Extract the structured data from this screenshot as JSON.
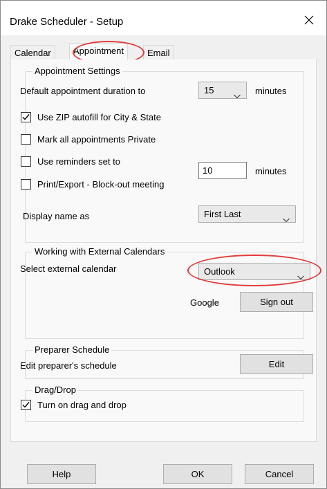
{
  "window": {
    "title": "Drake Scheduler - Setup"
  },
  "tabs": [
    {
      "label": "Calendar"
    },
    {
      "label": "Appointment"
    },
    {
      "label": "Email"
    }
  ],
  "appointment_settings": {
    "legend": "Appointment Settings",
    "duration_label": "Default appointment duration to",
    "duration_value": "15",
    "duration_unit": "minutes",
    "zip_autofill_label": "Use ZIP autofill for City & State",
    "zip_autofill_checked": true,
    "mark_private_label": "Mark all appointments Private",
    "mark_private_checked": false,
    "reminders_label": "Use reminders set to",
    "reminders_checked": false,
    "reminders_value": "10",
    "reminders_unit": "minutes",
    "print_export_label": "Print/Export - Block-out meeting",
    "print_export_checked": false,
    "display_name_label": "Display name as",
    "display_name_value": "First Last"
  },
  "external_calendars": {
    "legend": "Working with External Calendars",
    "select_label": "Select external calendar",
    "select_value": "Outlook",
    "google_label": "Google",
    "sign_out_label": "Sign out"
  },
  "preparer_schedule": {
    "legend": "Preparer Schedule",
    "edit_label": "Edit preparer's schedule",
    "edit_button": "Edit"
  },
  "drag_drop": {
    "legend": "Drag/Drop",
    "turn_on_label": "Turn on drag and drop",
    "turn_on_checked": true
  },
  "footer": {
    "help_label": "Help",
    "ok_label": "OK",
    "cancel_label": "Cancel"
  },
  "colors": {
    "highlight": "#e23b3b",
    "window_bg": "#f0f0f0",
    "panel_bg": "#f9f9f9"
  }
}
